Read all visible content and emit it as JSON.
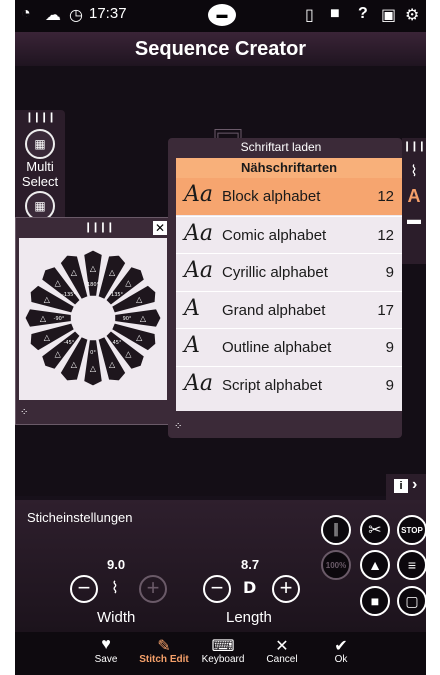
{
  "statusbar": {
    "time": "17:37"
  },
  "title": "Sequence Creator",
  "multiselect": {
    "label_line1": "Multi",
    "label_line2": "Select"
  },
  "rotation": {
    "labels": [
      "180°",
      "135°",
      "90°",
      "45°",
      "0°",
      "-45°",
      "-90°",
      "-135°"
    ]
  },
  "font_panel": {
    "title": "Schriftart laden",
    "category": "Nähschriftarten",
    "fonts": [
      {
        "glyph": "Aa",
        "name": "Block alphabet",
        "count": "12"
      },
      {
        "glyph": "Aa",
        "name": "Comic alphabet",
        "count": "12"
      },
      {
        "glyph": "Aa",
        "name": "Cyrillic alphabet",
        "count": "9"
      },
      {
        "glyph": "A",
        "name": "Grand alphabet",
        "count": "17"
      },
      {
        "glyph": "A",
        "name": "Outline alphabet",
        "count": "9"
      },
      {
        "glyph": "Aa",
        "name": "Script alphabet",
        "count": "9"
      }
    ]
  },
  "stitch": {
    "heading": "Sticheinstellungen",
    "width": {
      "value": "9.0",
      "label": "Width"
    },
    "length": {
      "value": "8.7",
      "label": "Length"
    },
    "tools": [
      "STOP",
      "100%"
    ]
  },
  "bottombar": {
    "save": "Save",
    "stitch_edit": "Stitch Edit",
    "keyboard": "Keyboard",
    "cancel": "Cancel",
    "ok": "Ok"
  },
  "colors": {
    "accent": "#f5a06a",
    "selected_row": "#f6a56f",
    "header_row": "#f8b07a"
  }
}
